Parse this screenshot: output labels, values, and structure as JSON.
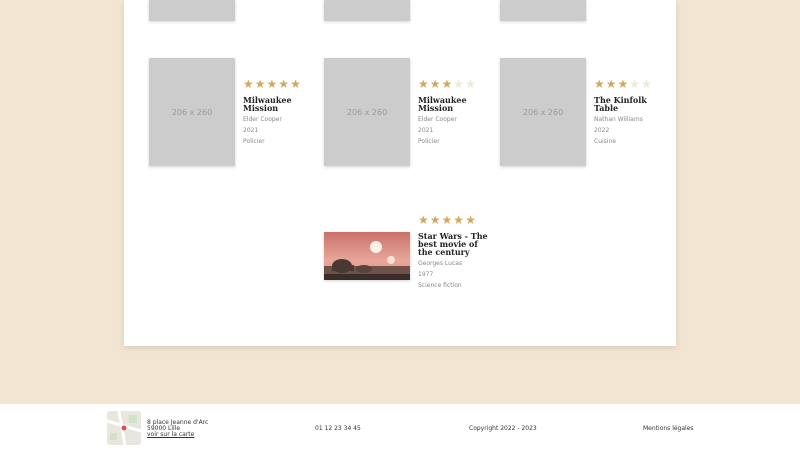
{
  "placeholder_label": "206 x 260",
  "books": [
    {
      "title": "Milwaukee Mission",
      "author": "Elder Cooper",
      "year": "2021",
      "genre": "Policier",
      "rating": 5
    },
    {
      "title": "Milwaukee Mission",
      "author": "Elder Cooper",
      "year": "2021",
      "genre": "Policier",
      "rating": 3
    },
    {
      "title": "The Kinfolk Table",
      "author": "Nathan Williams",
      "year": "2022",
      "genre": "Cuisine",
      "rating": 3
    },
    {
      "title": "Star Wars - The best movie of the century",
      "author": "Georges Lucas",
      "year": "1977",
      "genre": "Science fiction",
      "rating": 5
    }
  ],
  "footer": {
    "address_line1": "8 place Jeanne d'Arc",
    "address_line2": "59000 Lille",
    "map_link": "voir sur la carte",
    "phone": "01 12 23 34 45",
    "copyright": "Copyright 2022 - 2023",
    "legal": "Mentions légales"
  },
  "colors": {
    "star_on": "#d4a85a",
    "star_off": "#f0e8da",
    "background": "#f2e6d2"
  }
}
